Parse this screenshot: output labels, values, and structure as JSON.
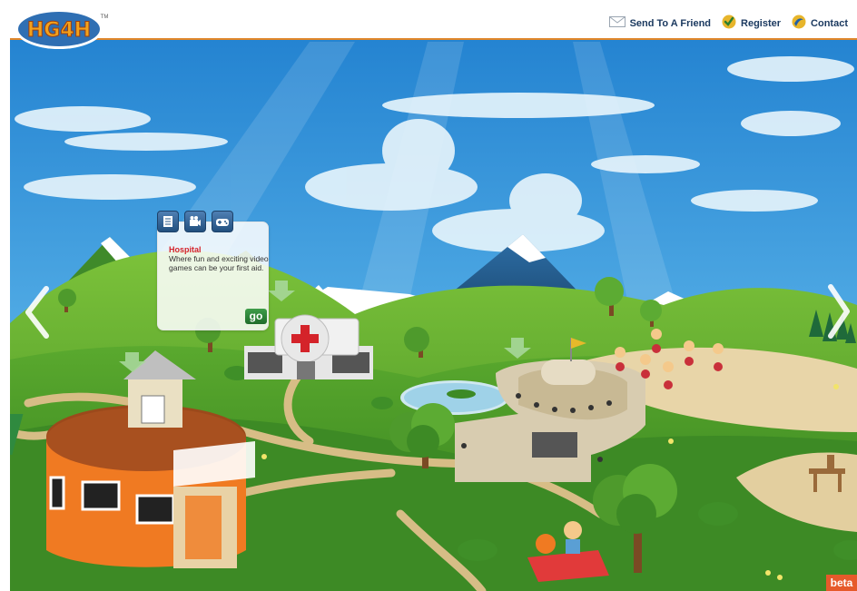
{
  "logo": {
    "text": "HG4H",
    "mark": "TM"
  },
  "nav": {
    "send_label": "Send To A Friend",
    "register_label": "Register",
    "contact_label": "Contact"
  },
  "popup": {
    "title": "Hospital",
    "description": "Where fun and exciting video games can be your first aid.",
    "go_label": "go",
    "icons": [
      "document-icon",
      "video-icon",
      "gamepad-icon"
    ]
  },
  "badge": {
    "beta_label": "beta"
  },
  "colors": {
    "sky": "#2f8fd6",
    "grass": "#4a9b2a",
    "path": "#dbc08a",
    "accent_orange": "#e0862a",
    "popup_title": "#d4232a",
    "go_green": "#2d8a3a",
    "beta": "#e65a2b"
  }
}
